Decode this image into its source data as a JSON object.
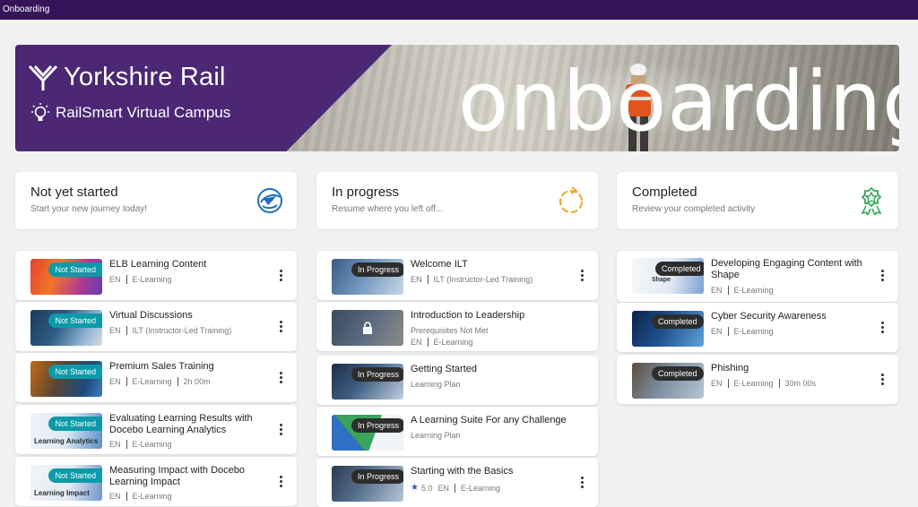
{
  "app": {
    "title": "Onboarding"
  },
  "banner": {
    "brand": "Yorkshire Rail",
    "campus": "RailSmart Virtual Campus",
    "headline": "onboarding"
  },
  "columns": [
    {
      "title": "Not yet started",
      "subtitle": "Start your new journey today!",
      "icon": "plane-globe-icon"
    },
    {
      "title": "In progress",
      "subtitle": "Resume where you left off...",
      "icon": "progress-circle-icon"
    },
    {
      "title": "Completed",
      "subtitle": "Review your completed activity",
      "icon": "award-badge-icon"
    }
  ],
  "not_started": [
    {
      "badge": "Not Started",
      "title": "ELB Learning Content",
      "lang": "EN",
      "type": "E-Learning"
    },
    {
      "badge": "Not Started",
      "title": "Virtual Discussions",
      "lang": "EN",
      "type": "ILT (Instructor-Led Training)"
    },
    {
      "badge": "Not Started",
      "title": "Premium Sales Training",
      "lang": "EN",
      "type": "E-Learning",
      "duration": "2h 00m"
    },
    {
      "badge": "Not Started",
      "title": "Evaluating Learning Results with Docebo Learning Analytics",
      "lang": "EN",
      "type": "E-Learning",
      "thumb_text": "Learning Analytics"
    },
    {
      "badge": "Not Started",
      "title": "Measuring Impact with Docebo Learning Impact",
      "lang": "EN",
      "type": "E-Learning",
      "thumb_text": "Learning Impact"
    }
  ],
  "in_progress": [
    {
      "badge": "In Progress",
      "title": "Welcome ILT",
      "lang": "EN",
      "type": "ILT (Instructor-Led Training)"
    },
    {
      "title": "Introduction to Leadership",
      "prereq": "Prerequisites Not Met",
      "lang": "EN",
      "type": "E-Learning",
      "locked": true
    },
    {
      "badge": "In Progress",
      "title": "Getting Started",
      "plan": "Learning Plan"
    },
    {
      "badge": "In Progress",
      "title": "A Learning Suite For any Challenge",
      "plan": "Learning Plan"
    },
    {
      "badge": "In Progress",
      "title": "Starting with the Basics",
      "rating": "5.0",
      "lang": "EN",
      "type": "E-Learning"
    }
  ],
  "completed": [
    {
      "badge": "Completed",
      "title": "Developing Engaging Content with Shape",
      "lang": "EN",
      "type": "E-Learning",
      "thumb_text": "Shape"
    },
    {
      "badge": "Completed",
      "title": "Cyber Security Awareness",
      "lang": "EN",
      "type": "E-Learning"
    },
    {
      "badge": "Completed",
      "title": "Phishing",
      "lang": "EN",
      "type": "E-Learning",
      "duration": "30m 00s"
    }
  ],
  "colors": {
    "topbar": "#35155a",
    "brand_purple": "#4b2774",
    "not_started_badge": "#0c9aa8",
    "dark_badge": "#2d2d2d",
    "in_progress_icon": "#e9a92a",
    "completed_icon": "#3aa45a",
    "not_started_icon": "#1f6fb8",
    "star": "#2b63c4"
  }
}
